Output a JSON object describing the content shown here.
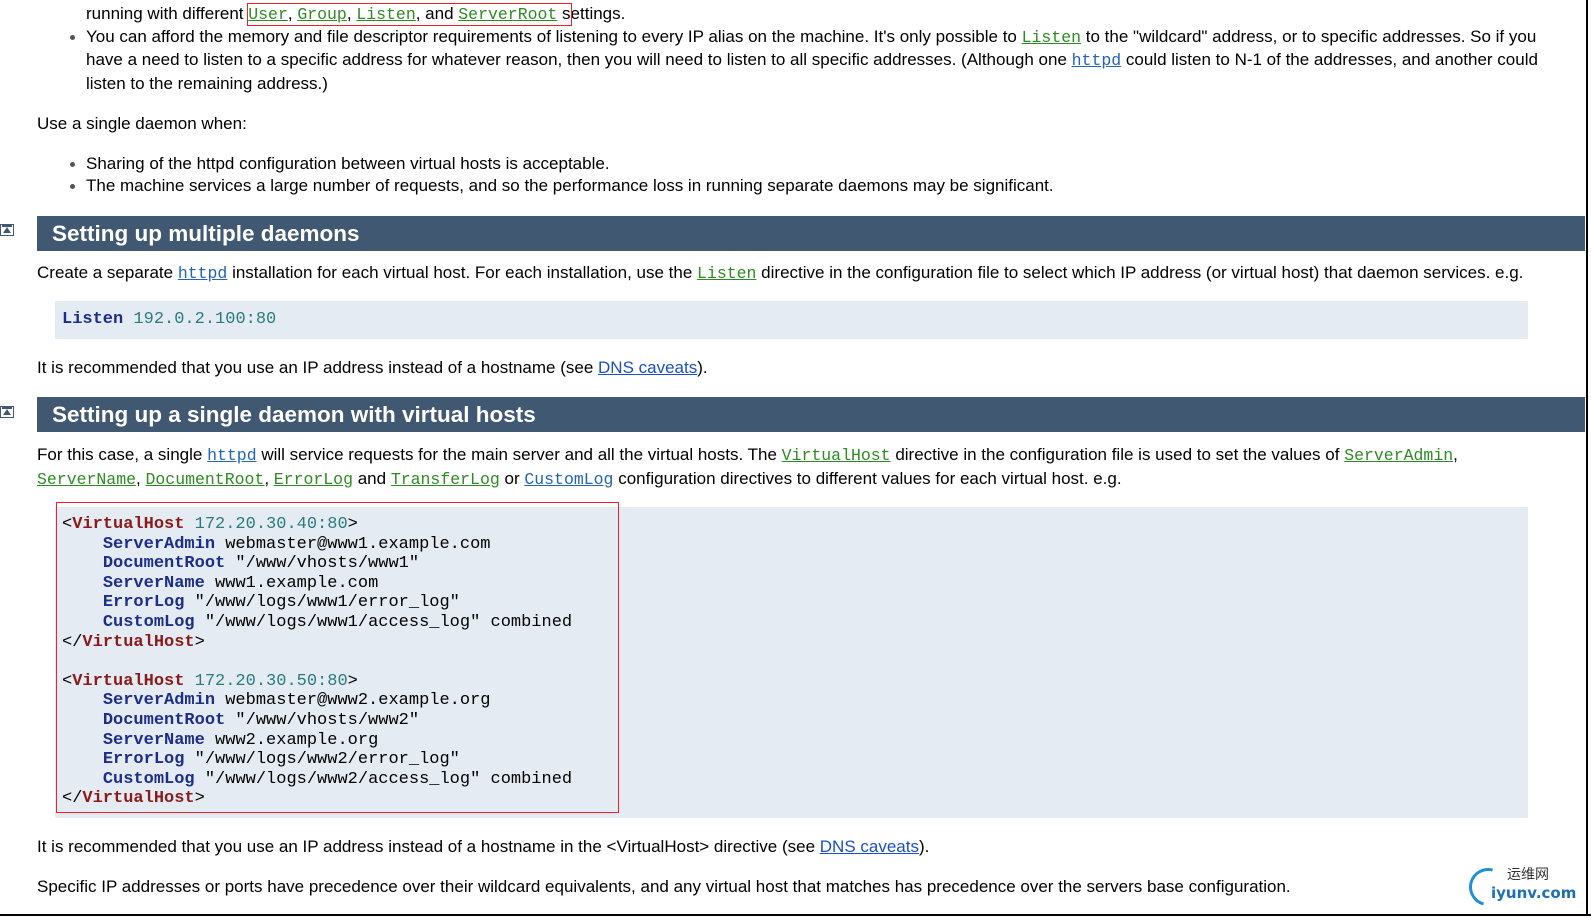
{
  "para_top": {
    "line1_prefix": "running with different",
    "line1_user": "User",
    "line1_sep1": ",",
    "line1_group": "Group",
    "line1_sep2": ",",
    "line1_listen": "Listen",
    "line1_and": ", and",
    "line1_serverroot": "ServerRoot",
    "line1_suffix": "settings."
  },
  "bullet2": {
    "line1_a": "You can afford the memory and file descriptor requirements of listening to every IP alias on the machine. It's only possible to",
    "line1_listen": "Listen",
    "line1_b": "to the \"wildcard\" address, or to specific addresses. So if you",
    "line2_a": "have a need to listen to a specific address for whatever reason, then you will need to listen to all specific addresses. (Although one",
    "line2_httpd": "httpd",
    "line2_b": "could listen to N-1 of the addresses, and another could",
    "line3": "listen to the remaining address.)"
  },
  "single_daemon_intro": "Use a single daemon when:",
  "single_daemon_bullets": [
    "Sharing of the httpd configuration between virtual hosts is acceptable.",
    "The machine services a large number of requests, and so the performance loss in running separate daemons may be significant."
  ],
  "section1": {
    "title": "Setting up multiple daemons",
    "p1_a": "Create a separate",
    "p1_httpd": "httpd",
    "p1_b": "installation for each virtual host. For each installation, use the",
    "p1_listen": "Listen",
    "p1_c": "directive in the configuration file to select which IP address (or virtual host) that daemon services. e.g.",
    "code_kw": "Listen",
    "code_val": "192.0.2.100:80",
    "p2_a": "It is recommended that you use an IP address instead of a hostname (see",
    "p2_link": "DNS caveats",
    "p2_b": ")."
  },
  "section2": {
    "title": "Setting up a single daemon with virtual hosts",
    "p1_a": "For this case, a single",
    "p1_httpd": "httpd",
    "p1_b": "will service requests for the main server and all the virtual hosts. The",
    "p1_virtualhost": "VirtualHost",
    "p1_c": "directive in the configuration file is used to set the values of",
    "p1_serveradmin": "ServerAdmin",
    "p1_comma": ",",
    "p2_servername": "ServerName",
    "p2_documentroot": "DocumentRoot",
    "p2_errorlog": "ErrorLog",
    "p2_and": "and",
    "p2_transferlog": "TransferLog",
    "p2_or": "or",
    "p2_customlog": "CustomLog",
    "p2_rest": "configuration directives to different values for each virtual host. e.g.",
    "code": [
      {
        "open": "<",
        "tag": "VirtualHost",
        "val": " 172.20.30.40:80",
        "close": ">"
      },
      {
        "indent": "    ",
        "kw": "ServerAdmin",
        "rest": " webmaster@www1.example.com"
      },
      {
        "indent": "    ",
        "kw": "DocumentRoot",
        "rest": " \"/www/vhosts/www1\""
      },
      {
        "indent": "    ",
        "kw": "ServerName",
        "rest": " www1.example.com"
      },
      {
        "indent": "    ",
        "kw": "ErrorLog",
        "rest": " \"/www/logs/www1/error_log\""
      },
      {
        "indent": "    ",
        "kw": "CustomLog",
        "rest": " \"/www/logs/www1/access_log\" combined"
      },
      {
        "open": "</",
        "tag": "VirtualHost",
        "val": "",
        "close": ">"
      },
      {
        "blank": true
      },
      {
        "open": "<",
        "tag": "VirtualHost",
        "val": " 172.20.30.50:80",
        "close": ">"
      },
      {
        "indent": "    ",
        "kw": "ServerAdmin",
        "rest": " webmaster@www2.example.org"
      },
      {
        "indent": "    ",
        "kw": "DocumentRoot",
        "rest": " \"/www/vhosts/www2\""
      },
      {
        "indent": "    ",
        "kw": "ServerName",
        "rest": " www2.example.org"
      },
      {
        "indent": "    ",
        "kw": "ErrorLog",
        "rest": " \"/www/logs/www2/error_log\""
      },
      {
        "indent": "    ",
        "kw": "CustomLog",
        "rest": " \"/www/logs/www2/access_log\" combined"
      },
      {
        "open": "</",
        "tag": "VirtualHost",
        "val": "",
        "close": ">"
      }
    ],
    "p3_a": "It is recommended that you use an IP address instead of a hostname in the <VirtualHost> directive (see",
    "p3_link": "DNS caveats",
    "p3_b": ").",
    "p4": "Specific IP addresses or ports have precedence over their wildcard equivalents, and any virtual host that matches has precedence over the servers base configuration."
  },
  "watermark": {
    "cn": "运维网",
    "en": "iyunv.com"
  }
}
